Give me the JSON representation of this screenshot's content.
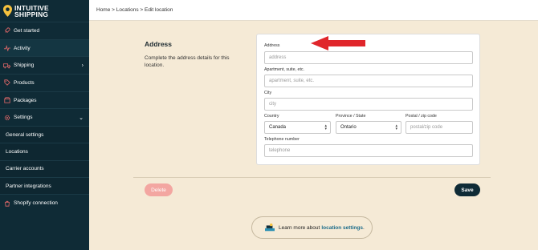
{
  "brand": {
    "line1": "INTUITIVE",
    "line2": "SHIPPING"
  },
  "sidebar": {
    "items": [
      {
        "label": "Get started",
        "icon": "rocket-icon"
      },
      {
        "label": "Activity",
        "icon": "activity-icon"
      },
      {
        "label": "Shipping",
        "icon": "truck-icon",
        "chevron": "›"
      },
      {
        "label": "Products",
        "icon": "tag-icon"
      },
      {
        "label": "Packages",
        "icon": "box-icon"
      },
      {
        "label": "Settings",
        "icon": "gear-icon",
        "chevron": "⌄"
      }
    ],
    "subitems": [
      {
        "label": "General settings"
      },
      {
        "label": "Locations"
      },
      {
        "label": "Carrier accounts"
      },
      {
        "label": "Partner integrations"
      }
    ],
    "bottom": {
      "label": "Shopify connection",
      "icon": "shopify-icon"
    }
  },
  "breadcrumb": "Home > Locations > Edit location",
  "section": {
    "title": "Address",
    "description": "Complete the address details for this location."
  },
  "form": {
    "address": {
      "label": "Address",
      "placeholder": "address"
    },
    "apt": {
      "label": "Apartment, suite, etc.",
      "placeholder": "apartment, suite, etc."
    },
    "city": {
      "label": "City",
      "placeholder": "city"
    },
    "country": {
      "label": "Country",
      "value": "Canada"
    },
    "province": {
      "label": "Province / State",
      "value": "Ontario"
    },
    "postal": {
      "label": "Postal / zip code",
      "placeholder": "postal/zip code"
    },
    "phone": {
      "label": "Telephone number",
      "placeholder": "telephone"
    }
  },
  "actions": {
    "delete": "Delete",
    "save": "Save"
  },
  "learn": {
    "prefix": "Learn more about",
    "link": "location settings",
    "suffix": "."
  },
  "colors": {
    "sidebar": "#0f2b36",
    "background": "#f5ead6",
    "delete": "#f3a6a1",
    "accent_arrow": "#e0262b",
    "link": "#1b6b8a"
  }
}
